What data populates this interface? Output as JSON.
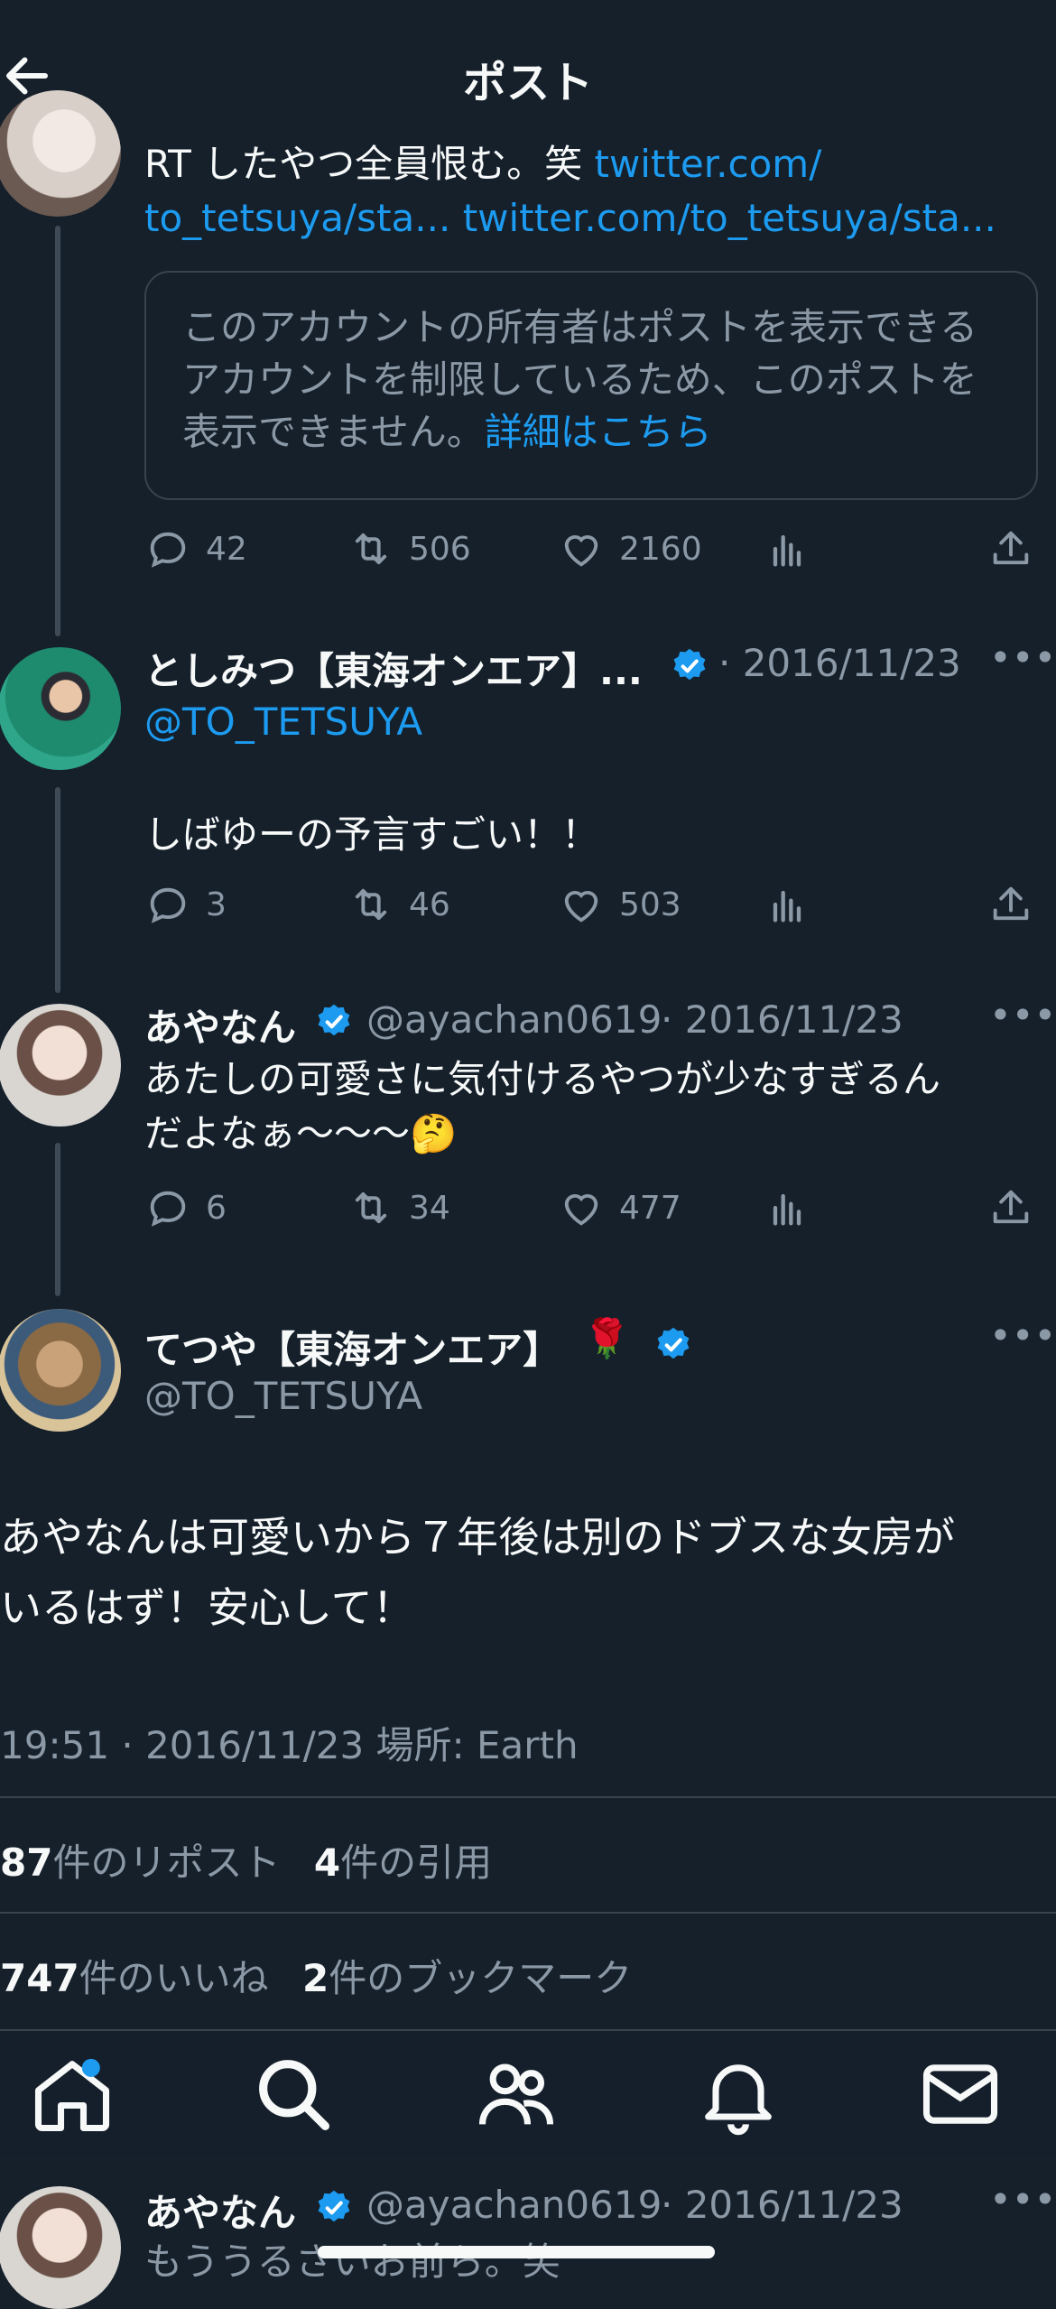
{
  "header": {
    "title": "ポスト"
  },
  "colors": {
    "background": "#15202b",
    "accent": "#1d9bf0",
    "muted": "#8b98a5",
    "text": "#f7f9f9"
  },
  "post1": {
    "text_prefix": "RT したやつ全員恨む。笑 ",
    "link1": "twitter.com/",
    "link2": "to_tetsuya/sta...",
    "link3": "twitter.com/to_tetsuya/sta...",
    "quote_text": "このアカウントの所有者はポストを表示できるアカウントを制限しているため、このポストを表示できません。",
    "quote_link": "詳細はこちら",
    "replies": "42",
    "reposts": "506",
    "likes": "2160"
  },
  "post2": {
    "name": "としみつ【東海オンエア】...",
    "date": "· 2016/11/23",
    "handle": "@TO_TETSUYA",
    "text": "しばゆーの予言すごい！！",
    "replies": "3",
    "reposts": "46",
    "likes": "503"
  },
  "post3": {
    "name": "あやなん",
    "handle": "@ayachan0619",
    "date": "· 2016/11/23",
    "text_line1": "あたしの可愛さに気付けるやつが少なすぎるん",
    "text_line2": "だよなぁ〜〜〜",
    "emoji": "🤔",
    "replies": "6",
    "reposts": "34",
    "likes": "477"
  },
  "main_post": {
    "name": "てつや【東海オンエア】",
    "emoji": "🌹",
    "handle": "@TO_TETSUYA",
    "text_line1": "あやなんは可愛いから７年後は別のドブスな女房が",
    "text_line2": "いるはず！安心して！",
    "meta": "19:51 · 2016/11/23 場所: Earth",
    "repost_count": "87",
    "repost_label": "件のリポスト",
    "quote_count": "4",
    "quote_label": "件の引用",
    "like_count": "747",
    "like_label": "件のいいね",
    "bookmark_count": "2",
    "bookmark_label": "件のブックマーク"
  },
  "reply": {
    "name": "あやなん",
    "handle": "@ayachan0619",
    "date": "· 2016/11/23",
    "text": "もううるさいお前ら。笑"
  },
  "tabbar": {
    "items": [
      "home-icon",
      "search-icon",
      "communities-icon",
      "notifications-icon",
      "messages-icon"
    ]
  }
}
